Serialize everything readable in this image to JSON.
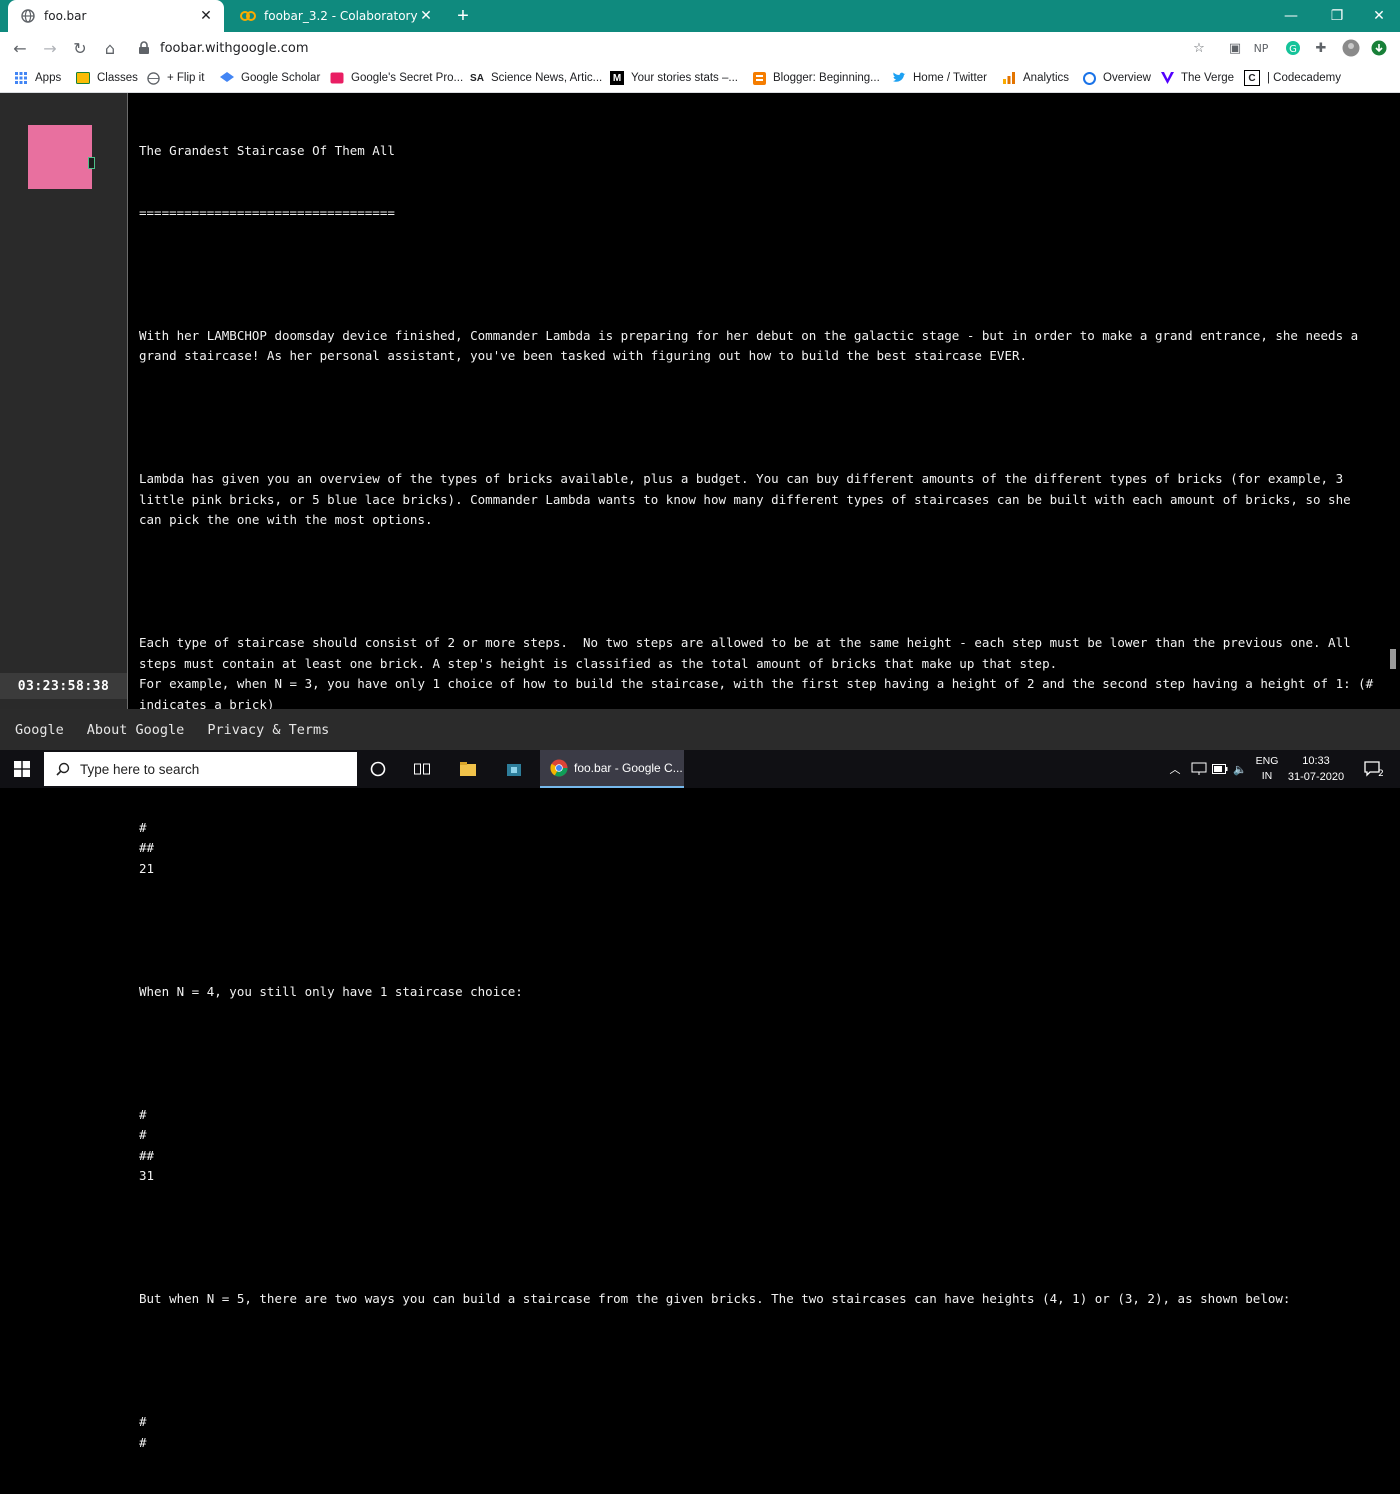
{
  "browser": {
    "tabs": [
      {
        "title": "foo.bar",
        "active": true,
        "icon": "globe-icon"
      },
      {
        "title": "foobar_3.2 - Colaboratory",
        "active": false,
        "icon": "colab-icon"
      }
    ],
    "url": "foobar.withgoogle.com",
    "toolbar_ext_np": "NP",
    "bookmarks": [
      {
        "label": "Apps",
        "icon": "apps-grid-icon"
      },
      {
        "label": "Classes",
        "icon": "classes-icon"
      },
      {
        "label": "+ Flip it",
        "icon": "globe-icon"
      },
      {
        "label": "Google Scholar",
        "icon": "scholar-icon"
      },
      {
        "label": "Google's Secret Pro...",
        "icon": "bookmark-icon"
      },
      {
        "label": "Science News, Artic...",
        "icon": "sa-icon",
        "icon_text": "SA"
      },
      {
        "label": "Your stories stats –...",
        "icon": "medium-icon",
        "icon_text": "M"
      },
      {
        "label": "Blogger: Beginning...",
        "icon": "blogger-icon"
      },
      {
        "label": "Home / Twitter",
        "icon": "twitter-icon"
      },
      {
        "label": "Analytics",
        "icon": "analytics-icon"
      },
      {
        "label": "Overview",
        "icon": "overview-icon"
      },
      {
        "label": "The Verge",
        "icon": "verge-icon"
      },
      {
        "label": "| Codecademy",
        "icon": "codecademy-icon",
        "icon_text": "C"
      }
    ]
  },
  "sidebar": {
    "timer": "03:23:58:38",
    "avatar_color": "#e8709f"
  },
  "challenge": {
    "title": "The Grandest Staircase Of Them All",
    "underline": "==================================",
    "paragraphs": [
      "With her LAMBCHOP doomsday device finished, Commander Lambda is preparing for her debut on the galactic stage - but in order to make a grand entrance, she needs a grand staircase! As her personal assistant, you've been tasked with figuring out how to build the best staircase EVER.",
      "Lambda has given you an overview of the types of bricks available, plus a budget. You can buy different amounts of the different types of bricks (for example, 3 little pink bricks, or 5 blue lace bricks). Commander Lambda wants to know how many different types of staircases can be built with each amount of bricks, so she can pick the one with the most options.",
      "Each type of staircase should consist of 2 or more steps.  No two steps are allowed to be at the same height - each step must be lower than the previous one. All steps must contain at least one brick. A step's height is classified as the total amount of bricks that make up that step.\nFor example, when N = 3, you have only 1 choice of how to build the staircase, with the first step having a height of 2 and the second step having a height of 1: (# indicates a brick)",
      "#\n##\n21",
      "When N = 4, you still only have 1 staircase choice:",
      "#\n#\n##\n31",
      "But when N = 5, there are two ways you can build a staircase from the given bricks. The two staircases can have heights (4, 1) or (3, 2), as shown below:",
      "#\n#"
    ]
  },
  "footer": {
    "links": [
      "Google",
      "About Google",
      "Privacy & Terms"
    ]
  },
  "taskbar": {
    "search_placeholder": "Type here to search",
    "app_label": "foo.bar - Google C...",
    "lang_top": "ENG",
    "lang_bottom": "IN",
    "time": "10:33",
    "date": "31-07-2020",
    "notification_count": "2"
  },
  "colors": {
    "tabstrip": "#0f8a7e",
    "page_bg": "#000000",
    "sidebar_bg": "#2a2a2a",
    "footer_bg": "#2b2b2b",
    "taskbar_bg": "#101014"
  }
}
